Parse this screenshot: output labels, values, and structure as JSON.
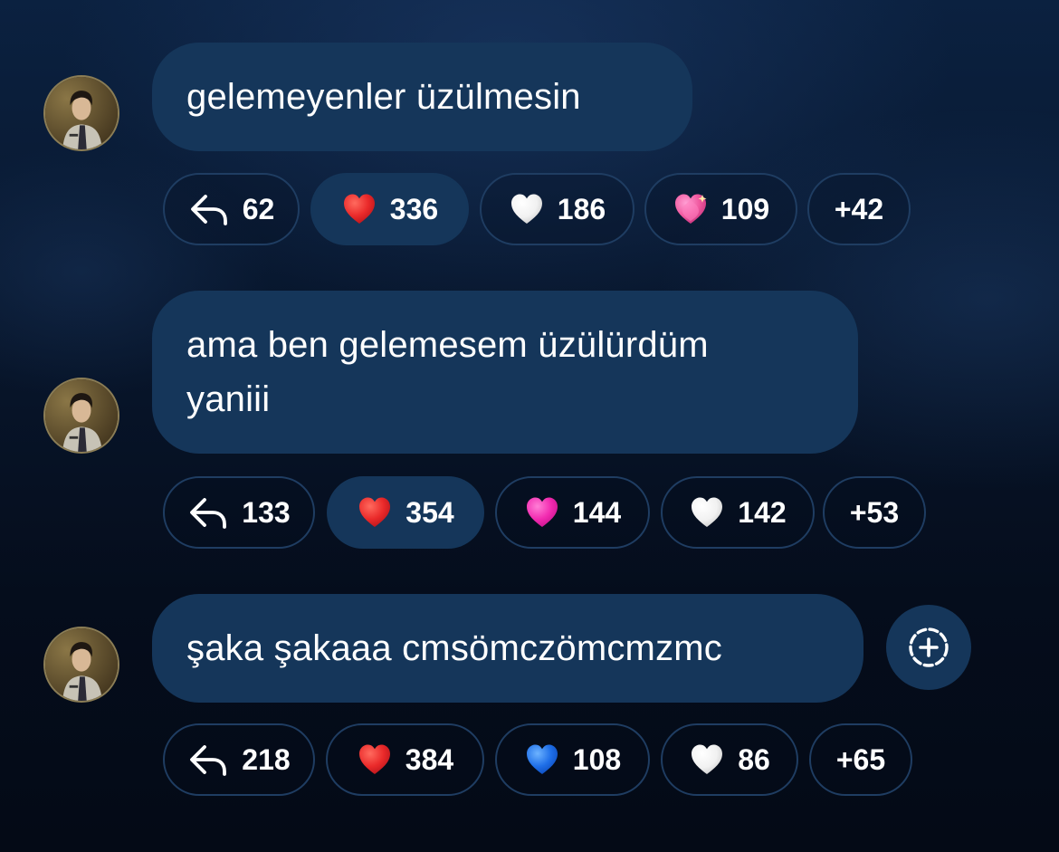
{
  "colors": {
    "bubble": "#15365a",
    "pill_border": "#1f3d62",
    "text": "#ffffff",
    "background": "#050d1c"
  },
  "messages": [
    {
      "lines": [
        "gelemeyenler üzülmesin"
      ],
      "reactions": [
        {
          "icon": "reply-icon",
          "count": "62"
        },
        {
          "icon": "red-heart-icon",
          "count": "336",
          "selected": true
        },
        {
          "icon": "white-heart-icon",
          "count": "186"
        },
        {
          "icon": "sparkling-heart-icon",
          "count": "109"
        },
        {
          "icon": "more",
          "count": "+42"
        }
      ]
    },
    {
      "lines": [
        "ama ben gelemesem üzülürdüm",
        "yaniii"
      ],
      "reactions": [
        {
          "icon": "reply-icon",
          "count": "133"
        },
        {
          "icon": "red-heart-icon",
          "count": "354",
          "selected": true
        },
        {
          "icon": "pink-heart-icon",
          "count": "144"
        },
        {
          "icon": "white-heart-icon",
          "count": "142"
        },
        {
          "icon": "more",
          "count": "+53"
        }
      ]
    },
    {
      "lines": [
        "şaka şakaaa cmsömczömcmzmc"
      ],
      "reactions": [
        {
          "icon": "reply-icon",
          "count": "218"
        },
        {
          "icon": "red-heart-icon",
          "count": "384"
        },
        {
          "icon": "blue-heart-icon",
          "count": "108"
        },
        {
          "icon": "white-heart-icon",
          "count": "86"
        },
        {
          "icon": "more",
          "count": "+65"
        }
      ]
    }
  ],
  "add_reaction_icon": "add-reaction-icon"
}
